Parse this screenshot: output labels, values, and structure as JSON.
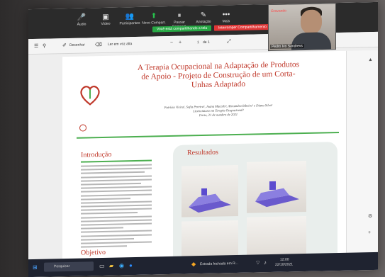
{
  "zoom_toolbar": {
    "items": [
      {
        "label": "Áudio",
        "icon": "microphone-icon"
      },
      {
        "label": "Vídeo",
        "icon": "video-camera-icon"
      },
      {
        "label": "Participantes",
        "icon": "participants-icon",
        "count": "5"
      },
      {
        "label": "Novo Compart.",
        "icon": "share-screen-icon"
      },
      {
        "label": "Pausar Compart.",
        "icon": "pause-icon"
      },
      {
        "label": "Anotação",
        "icon": "pen-icon"
      },
      {
        "label": "Mais",
        "icon": "more-icon"
      }
    ],
    "share_banner": "Você está compartilhando a tela",
    "stop_share": "Interromper Compartilhamento"
  },
  "browser_toolbar": {
    "draw_label": "Desenhar",
    "read_aloud": "Ler em voz alta",
    "page_current": "1",
    "page_total": "de 1"
  },
  "video": {
    "name": "Pedro Ivo Sandrevs",
    "rec": "Gravando"
  },
  "document": {
    "title": "A Terapia Ocupacional na Adaptação de Produtos de Apoio - Projeto de Construção de um Corta-Unhas Adaptado",
    "authors": "Patrícia Vieira¹, Sofia Pereira¹, Joana Macedo², Alexandra Ribeiro¹ e Diana Silva¹",
    "affiliation": "Licenciatura em Terapia Ocupacional¹",
    "date": "Porto, 21 de outubro de 2021",
    "intro_heading": "Introdução",
    "results_heading": "Resultados",
    "objective_heading": "Objetivo"
  },
  "taskbar": {
    "search_placeholder": "Pesquisar",
    "weather": "Estrada fechada em R...",
    "time": "12:00",
    "date": "22/10/2021"
  },
  "colors": {
    "title_red": "#c0392b",
    "accent_green": "#4caf50",
    "zoom_bar": "#2b2b2b",
    "share_green": "#27a844",
    "stop_red": "#e03636"
  }
}
